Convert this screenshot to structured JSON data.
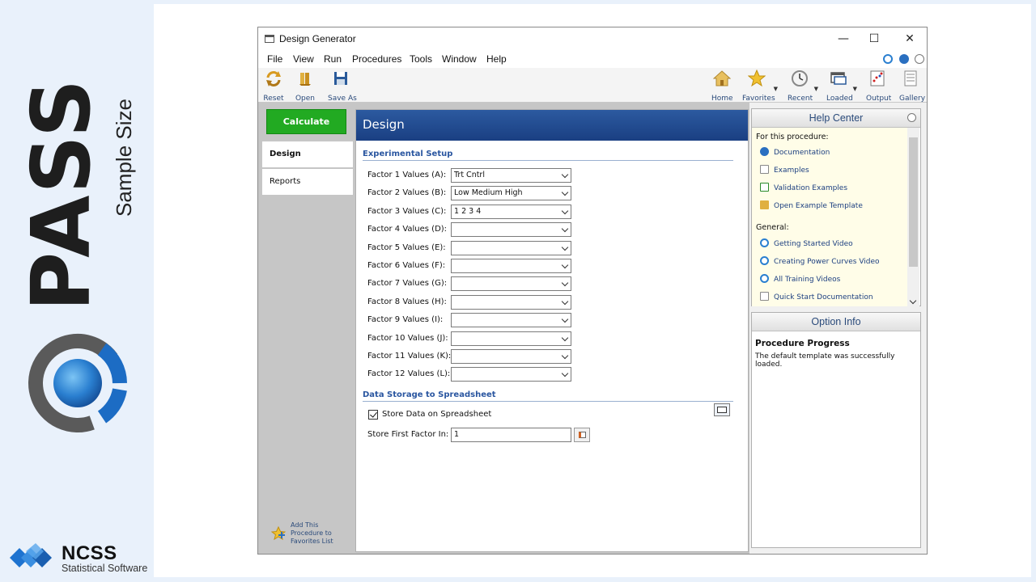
{
  "branding": {
    "product": "PASS",
    "tagline": "Sample Size",
    "company": "NCSS",
    "company_sub": "Statistical Software"
  },
  "window": {
    "title": "Design Generator",
    "controls": {
      "minimize": "—",
      "maximize": "☐",
      "close": "✕"
    }
  },
  "menu": [
    "File",
    "View",
    "Run",
    "Procedures",
    "Tools",
    "Window",
    "Help"
  ],
  "toolbar": {
    "left": [
      {
        "label": "Reset",
        "icon": "reset-icon"
      },
      {
        "label": "Open",
        "icon": "open-icon"
      },
      {
        "label": "Save As",
        "icon": "save-icon"
      }
    ],
    "right": [
      {
        "label": "Home",
        "icon": "home-icon"
      },
      {
        "label": "Favorites",
        "icon": "star-icon"
      },
      {
        "label": "Recent",
        "icon": "clock-icon"
      },
      {
        "label": "Loaded",
        "icon": "window-icon"
      },
      {
        "label": "Output",
        "icon": "output-icon"
      },
      {
        "label": "Gallery",
        "icon": "gallery-icon"
      }
    ]
  },
  "leftnav": {
    "calculate": "Calculate",
    "tabs": [
      "Design",
      "Reports"
    ],
    "add_favorites": "Add This Procedure to Favorites List"
  },
  "main": {
    "header": "Design",
    "section1": "Experimental Setup",
    "fields": [
      {
        "label": "Factor 1 Values (A):",
        "value": "Trt Cntrl"
      },
      {
        "label": "Factor 2 Values (B):",
        "value": "Low Medium High"
      },
      {
        "label": "Factor 3 Values (C):",
        "value": "1 2 3 4"
      },
      {
        "label": "Factor 4 Values (D):",
        "value": ""
      },
      {
        "label": "Factor 5 Values (E):",
        "value": ""
      },
      {
        "label": "Factor 6 Values (F):",
        "value": ""
      },
      {
        "label": "Factor 7 Values (G):",
        "value": ""
      },
      {
        "label": "Factor 8 Values (H):",
        "value": ""
      },
      {
        "label": "Factor 9 Values (I):",
        "value": ""
      },
      {
        "label": "Factor 10 Values (J):",
        "value": ""
      },
      {
        "label": "Factor 11 Values (K):",
        "value": ""
      },
      {
        "label": "Factor 12 Values (L):",
        "value": ""
      }
    ],
    "section2": "Data Storage to Spreadsheet",
    "store_checkbox_label": "Store Data on Spreadsheet",
    "store_first_label": "Store First Factor In:",
    "store_first_value": "1"
  },
  "help": {
    "title": "Help Center",
    "sub1": "For this procedure:",
    "links1": [
      {
        "label": "Documentation",
        "icon": "help-circle-icon"
      },
      {
        "label": "Examples",
        "icon": "example-icon"
      },
      {
        "label": "Validation Examples",
        "icon": "validation-icon"
      },
      {
        "label": "Open Example Template",
        "icon": "template-icon"
      }
    ],
    "sub2": "General:",
    "links2": [
      {
        "label": "Getting Started Video",
        "icon": "play-icon"
      },
      {
        "label": "Creating Power Curves Video",
        "icon": "play-icon"
      },
      {
        "label": "All Training Videos",
        "icon": "play-icon"
      },
      {
        "label": "Quick Start Documentation",
        "icon": "document-icon"
      }
    ]
  },
  "option": {
    "title": "Option Info",
    "heading": "Procedure Progress",
    "text": "The default template was successfully loaded."
  },
  "colors": {
    "accent": "#2c5aa0",
    "calculate": "#22aa22",
    "link": "#1c3f80"
  }
}
